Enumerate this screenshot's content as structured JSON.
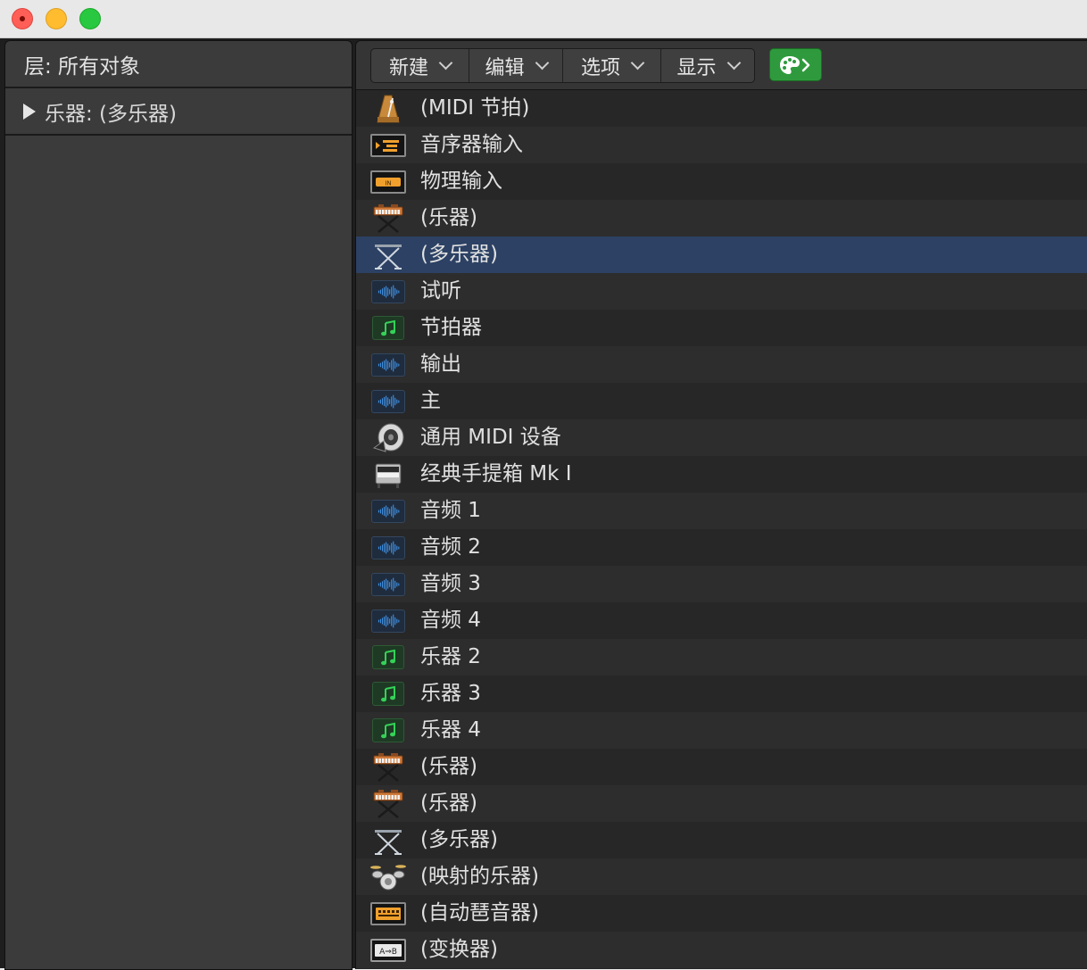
{
  "window": {
    "traffic_lights": [
      "close",
      "minimize",
      "zoom"
    ]
  },
  "left_pane": {
    "header_label": "层: 所有对象",
    "items": [
      {
        "label": "乐器: (多乐器)"
      }
    ]
  },
  "toolbar": {
    "menus": [
      {
        "label": "新建"
      },
      {
        "label": "编辑"
      },
      {
        "label": "选项"
      },
      {
        "label": "显示"
      }
    ],
    "palette_button_icon": "palette-icon"
  },
  "objects": [
    {
      "label": "(MIDI 节拍)",
      "icon": "metronome-icon"
    },
    {
      "label": "音序器输入",
      "icon": "sequencer-input-icon"
    },
    {
      "label": "物理输入",
      "icon": "physical-input-icon"
    },
    {
      "label": "(乐器)",
      "icon": "keyboard-instrument-icon"
    },
    {
      "label": "(多乐器)",
      "icon": "keyboard-stand-icon",
      "selected": true
    },
    {
      "label": "试听",
      "icon": "audio-waveform-icon"
    },
    {
      "label": "节拍器",
      "icon": "music-note-icon"
    },
    {
      "label": "输出",
      "icon": "audio-waveform-icon"
    },
    {
      "label": "主",
      "icon": "audio-waveform-icon"
    },
    {
      "label": "通用 MIDI 设备",
      "icon": "speaker-icon"
    },
    {
      "label": "经典手提箱 Mk I",
      "icon": "electric-piano-icon"
    },
    {
      "label": "音频 1",
      "icon": "audio-waveform-icon"
    },
    {
      "label": "音频 2",
      "icon": "audio-waveform-icon"
    },
    {
      "label": "音频 3",
      "icon": "audio-waveform-icon"
    },
    {
      "label": "音频 4",
      "icon": "audio-waveform-icon"
    },
    {
      "label": "乐器 2",
      "icon": "music-note-icon"
    },
    {
      "label": "乐器 3",
      "icon": "music-note-icon"
    },
    {
      "label": "乐器 4",
      "icon": "music-note-icon"
    },
    {
      "label": "(乐器)",
      "icon": "keyboard-instrument-icon"
    },
    {
      "label": "(乐器)",
      "icon": "keyboard-instrument-icon"
    },
    {
      "label": "(多乐器)",
      "icon": "keyboard-stand-icon"
    },
    {
      "label": "(映射的乐器)",
      "icon": "drum-kit-icon"
    },
    {
      "label": "(自动琶音器)",
      "icon": "arpeggiator-icon"
    },
    {
      "label": "(变换器)",
      "icon": "transformer-icon"
    }
  ],
  "colors": {
    "selection": "#2c4164",
    "palette_button": "#2f9a3d",
    "audio_icon": "#3f8fe0",
    "note_icon": "#35d158"
  }
}
